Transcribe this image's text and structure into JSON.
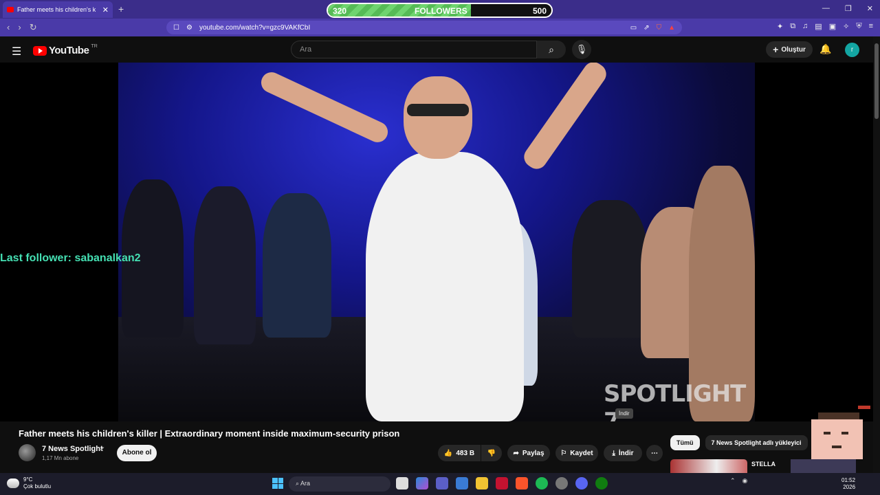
{
  "browser": {
    "tab_title": "Father meets his children's k",
    "url": "youtube.com/watch?v=gzc9VAKfCbI"
  },
  "followers_overlay": {
    "current": "320",
    "label": "FOLLOWERS",
    "goal": "500",
    "progress_fraction": 0.64
  },
  "youtube": {
    "logo_text": "YouTube",
    "country_code": "TR",
    "search_placeholder": "Ara",
    "create_label": "Oluştur",
    "avatar_letter": "r"
  },
  "stream_overlay": {
    "last_follower": "Last follower: sabanalkan2"
  },
  "video": {
    "watermark": "SPOTLIGHT 7",
    "title": "Father meets his children's killer | Extraordinary moment inside maximum-security prison",
    "tooltip": "İndir"
  },
  "channel": {
    "name": "7 News Spotlight",
    "subscribers": "1,17 Mn abone",
    "subscribe_label": "Abone ol"
  },
  "actions": {
    "likes": "483 B",
    "share_label": "Paylaş",
    "save_label": "Kaydet",
    "download_label": "İndir"
  },
  "sidebar": {
    "chips": [
      "Tümü",
      "7 News Spotlight adlı yükleyici"
    ],
    "first_video_title": "STELLA"
  },
  "taskbar": {
    "weather_temp": "9°C",
    "weather_desc": "Çok bulutlu",
    "search_label": "Ara",
    "time": "01:52",
    "date": "2026"
  },
  "colors": {
    "youtube_red": "#ff0000",
    "browser_purple": "#3b2d8a",
    "follower_green": "#45e0b3",
    "progress_green": "#6fd46f"
  }
}
